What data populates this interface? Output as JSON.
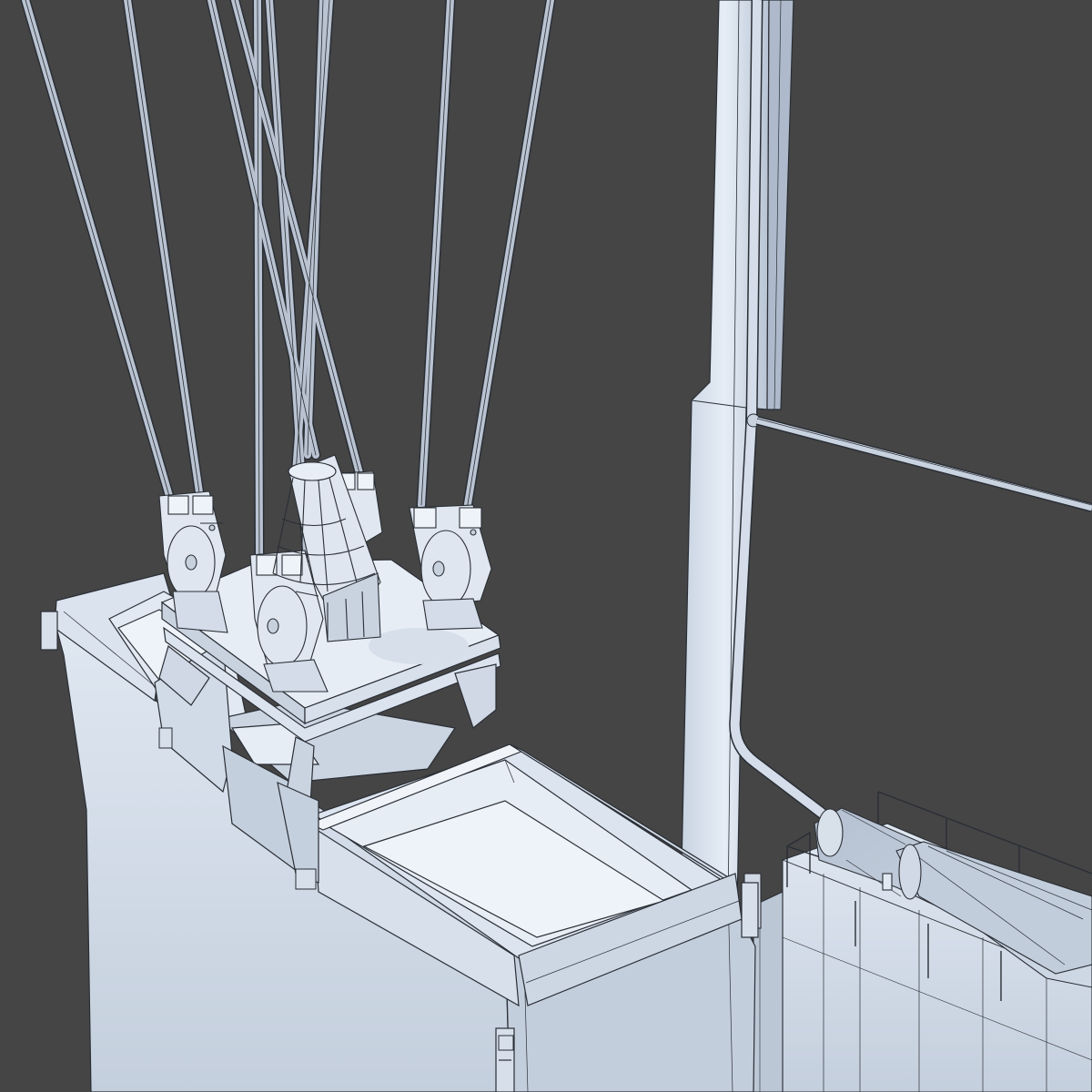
{
  "scene": {
    "subject": "crane-spreader-3d-wireframe-render",
    "colors": {
      "background": "#454545",
      "surface_light": "#e4ebf4",
      "surface_mid": "#c9d4e2",
      "surface_dark": "#a9b6c8",
      "wire": "#2a2e35",
      "cable_fill": "#b9c3d1"
    }
  }
}
